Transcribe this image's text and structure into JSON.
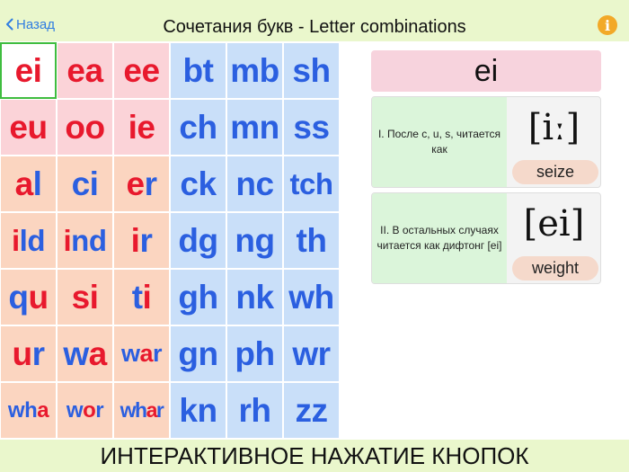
{
  "header": {
    "back_label": "Назад",
    "title": "Сочетания букв - Letter combinations",
    "info_icon": "info-icon"
  },
  "grid": [
    [
      {
        "parts": [
          {
            "t": "ei",
            "c": "red"
          }
        ],
        "bg": "selected",
        "size": "l"
      },
      {
        "parts": [
          {
            "t": "ea",
            "c": "red"
          }
        ],
        "bg": "pink",
        "size": "l"
      },
      {
        "parts": [
          {
            "t": "ee",
            "c": "red"
          }
        ],
        "bg": "pink",
        "size": "l"
      },
      {
        "parts": [
          {
            "t": "bt",
            "c": "blue"
          }
        ],
        "bg": "blue",
        "size": "l"
      },
      {
        "parts": [
          {
            "t": "mb",
            "c": "blue"
          }
        ],
        "bg": "blue",
        "size": "l"
      },
      {
        "parts": [
          {
            "t": "sh",
            "c": "blue"
          }
        ],
        "bg": "blue",
        "size": "l"
      }
    ],
    [
      {
        "parts": [
          {
            "t": "eu",
            "c": "red"
          }
        ],
        "bg": "pink",
        "size": "l"
      },
      {
        "parts": [
          {
            "t": "oo",
            "c": "red"
          }
        ],
        "bg": "pink",
        "size": "l"
      },
      {
        "parts": [
          {
            "t": "ie",
            "c": "red"
          }
        ],
        "bg": "pink",
        "size": "l"
      },
      {
        "parts": [
          {
            "t": "ch",
            "c": "blue"
          }
        ],
        "bg": "blue",
        "size": "l"
      },
      {
        "parts": [
          {
            "t": "mn",
            "c": "blue"
          }
        ],
        "bg": "blue",
        "size": "l"
      },
      {
        "parts": [
          {
            "t": "ss",
            "c": "blue"
          }
        ],
        "bg": "blue",
        "size": "l"
      }
    ],
    [
      {
        "parts": [
          {
            "t": "a",
            "c": "red"
          },
          {
            "t": "l",
            "c": "blue"
          }
        ],
        "bg": "peach",
        "size": "l"
      },
      {
        "parts": [
          {
            "t": "ci",
            "c": "blue"
          }
        ],
        "bg": "peach",
        "size": "l"
      },
      {
        "parts": [
          {
            "t": "e",
            "c": "red"
          },
          {
            "t": "r",
            "c": "blue"
          }
        ],
        "bg": "peach",
        "size": "l"
      },
      {
        "parts": [
          {
            "t": "ck",
            "c": "blue"
          }
        ],
        "bg": "blue",
        "size": "l"
      },
      {
        "parts": [
          {
            "t": "nc",
            "c": "blue"
          }
        ],
        "bg": "blue",
        "size": "l"
      },
      {
        "parts": [
          {
            "t": "tch",
            "c": "blue"
          }
        ],
        "bg": "blue",
        "size": "m"
      }
    ],
    [
      {
        "parts": [
          {
            "t": "i",
            "c": "red"
          },
          {
            "t": "ld",
            "c": "blue"
          }
        ],
        "bg": "peach",
        "size": "m"
      },
      {
        "parts": [
          {
            "t": "i",
            "c": "red"
          },
          {
            "t": "nd",
            "c": "blue"
          }
        ],
        "bg": "peach",
        "size": "m"
      },
      {
        "parts": [
          {
            "t": "i",
            "c": "red"
          },
          {
            "t": "r",
            "c": "blue"
          }
        ],
        "bg": "peach",
        "size": "l"
      },
      {
        "parts": [
          {
            "t": "dg",
            "c": "blue"
          }
        ],
        "bg": "blue",
        "size": "l"
      },
      {
        "parts": [
          {
            "t": "ng",
            "c": "blue"
          }
        ],
        "bg": "blue",
        "size": "l"
      },
      {
        "parts": [
          {
            "t": "th",
            "c": "blue"
          }
        ],
        "bg": "blue",
        "size": "l"
      }
    ],
    [
      {
        "parts": [
          {
            "t": "q",
            "c": "blue"
          },
          {
            "t": "u",
            "c": "red"
          }
        ],
        "bg": "peach",
        "size": "l"
      },
      {
        "parts": [
          {
            "t": "si",
            "c": "red"
          }
        ],
        "bg": "peach",
        "size": "l"
      },
      {
        "parts": [
          {
            "t": "t",
            "c": "blue"
          },
          {
            "t": "i",
            "c": "red"
          }
        ],
        "bg": "peach",
        "size": "l"
      },
      {
        "parts": [
          {
            "t": "gh",
            "c": "blue"
          }
        ],
        "bg": "blue",
        "size": "l"
      },
      {
        "parts": [
          {
            "t": "nk",
            "c": "blue"
          }
        ],
        "bg": "blue",
        "size": "l"
      },
      {
        "parts": [
          {
            "t": "wh",
            "c": "blue"
          }
        ],
        "bg": "blue",
        "size": "l"
      }
    ],
    [
      {
        "parts": [
          {
            "t": "u",
            "c": "red"
          },
          {
            "t": "r",
            "c": "blue"
          }
        ],
        "bg": "peach",
        "size": "l"
      },
      {
        "parts": [
          {
            "t": "w",
            "c": "blue"
          },
          {
            "t": "a",
            "c": "red"
          }
        ],
        "bg": "peach",
        "size": "l"
      },
      {
        "parts": [
          {
            "t": "w",
            "c": "blue"
          },
          {
            "t": "a",
            "c": "red"
          },
          {
            "t": "r",
            "c": "blue"
          }
        ],
        "bg": "peach",
        "size": "s"
      },
      {
        "parts": [
          {
            "t": "gn",
            "c": "blue"
          }
        ],
        "bg": "blue",
        "size": "l"
      },
      {
        "parts": [
          {
            "t": "ph",
            "c": "blue"
          }
        ],
        "bg": "blue",
        "size": "l"
      },
      {
        "parts": [
          {
            "t": "wr",
            "c": "blue"
          }
        ],
        "bg": "blue",
        "size": "l"
      }
    ],
    [
      {
        "parts": [
          {
            "t": "wh",
            "c": "blue"
          },
          {
            "t": "a",
            "c": "red"
          }
        ],
        "bg": "peach",
        "size": "xs"
      },
      {
        "parts": [
          {
            "t": "w",
            "c": "blue"
          },
          {
            "t": "o",
            "c": "red"
          },
          {
            "t": "r",
            "c": "blue"
          }
        ],
        "bg": "peach",
        "size": "xs"
      },
      {
        "parts": [
          {
            "t": "wh",
            "c": "blue"
          },
          {
            "t": "a",
            "c": "red"
          },
          {
            "t": "r",
            "c": "blue"
          }
        ],
        "bg": "peach",
        "size": "xxs"
      },
      {
        "parts": [
          {
            "t": "kn",
            "c": "blue"
          }
        ],
        "bg": "blue",
        "size": "l"
      },
      {
        "parts": [
          {
            "t": "rh",
            "c": "blue"
          }
        ],
        "bg": "blue",
        "size": "l"
      },
      {
        "parts": [
          {
            "t": "zz",
            "c": "blue"
          }
        ],
        "bg": "blue",
        "size": "l"
      }
    ]
  ],
  "detail": {
    "selected": "ei",
    "rules": [
      {
        "text": "I. После c, u, s, читается как",
        "ipa": "[iː]",
        "example": "seize"
      },
      {
        "text": "II. В остальных случаях читается как дифтонг [ei]",
        "ipa": "[ei]",
        "example": "weight"
      }
    ]
  },
  "footer": {
    "banner": "ИНТЕРАКТИВНОЕ НАЖАТИЕ КНОПОК"
  },
  "colors": {
    "vowel": "#e8192d",
    "consonant": "#2b5fe0",
    "header_bg": "#eaf7cc",
    "accent_link": "#2f7de1",
    "info": "#f2a928"
  }
}
